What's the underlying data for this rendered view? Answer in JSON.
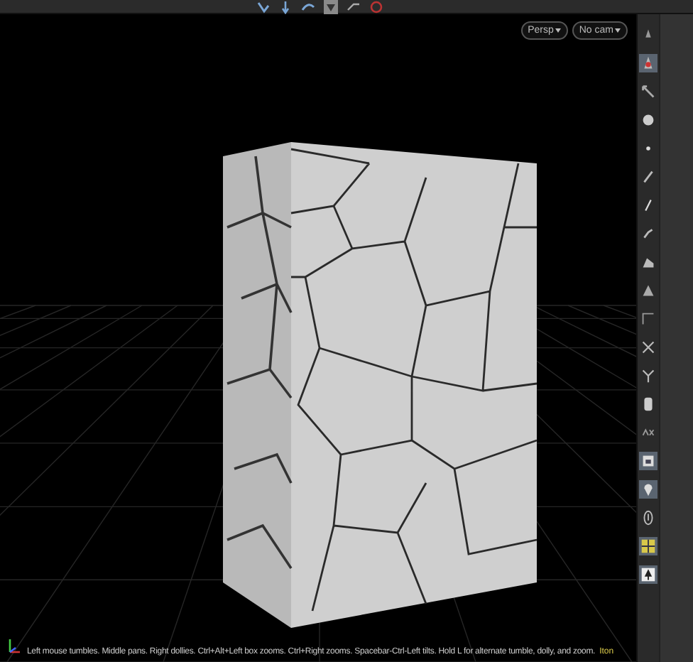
{
  "viewport": {
    "camera_menus": [
      {
        "label": "Persp"
      },
      {
        "label": "No cam"
      }
    ],
    "status_text": "Left mouse tumbles. Middle pans. Right dollies. Ctrl+Alt+Left box zooms. Ctrl+Right zooms. Spacebar-Ctrl-Left tilts. Hold L for alternate tumble, dolly, and zoom.",
    "status_tail": "Iton"
  },
  "top_toolbar": [
    {
      "selected": false
    },
    {
      "selected": false
    },
    {
      "selected": false
    },
    {
      "selected": true
    },
    {
      "selected": false
    },
    {
      "selected": false
    }
  ],
  "right_toolbar": [
    {
      "selected": false
    },
    {
      "selected": true
    },
    {
      "selected": false
    },
    {
      "selected": false
    },
    {
      "selected": false
    },
    {
      "selected": false
    },
    {
      "selected": false
    },
    {
      "selected": false
    },
    {
      "selected": false
    },
    {
      "selected": false
    },
    {
      "selected": false
    },
    {
      "selected": false
    },
    {
      "selected": false
    },
    {
      "selected": false
    },
    {
      "selected": false
    },
    {
      "selected": true
    },
    {
      "selected": true
    },
    {
      "selected": false
    },
    {
      "selected": true
    },
    {
      "selected": true
    }
  ]
}
